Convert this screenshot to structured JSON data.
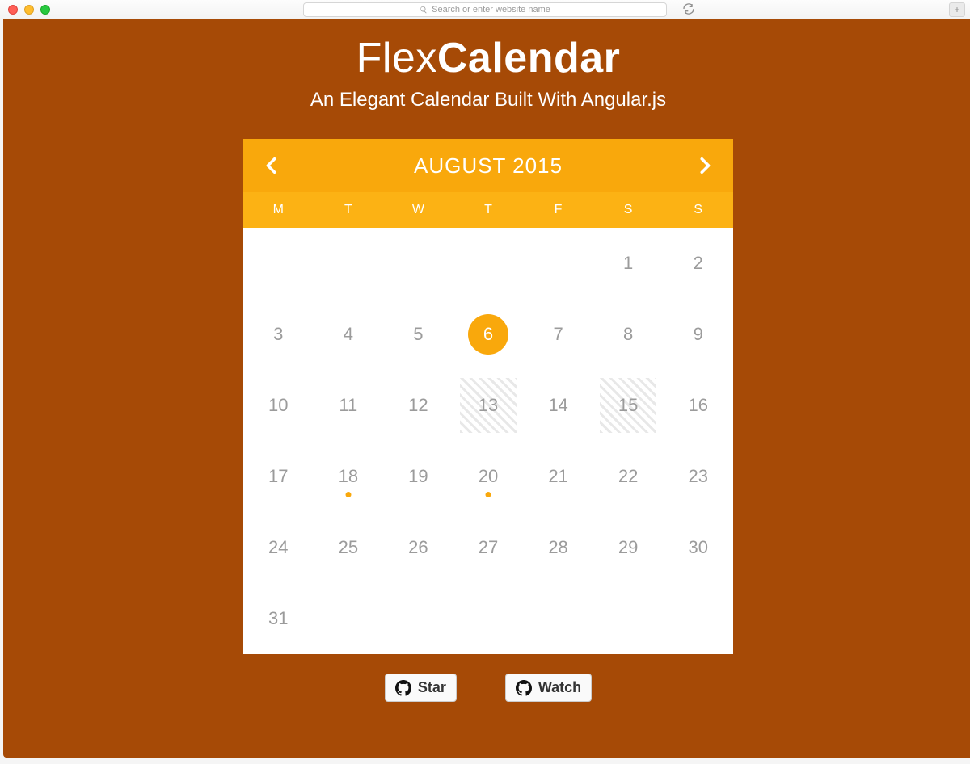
{
  "browser": {
    "placeholder": "Search or enter website name"
  },
  "header": {
    "title_light": "Flex",
    "title_bold": "Calendar",
    "subtitle": "An Elegant Calendar Built With Angular.js"
  },
  "calendar": {
    "month_label": "AUGUST 2015",
    "weekdays": [
      "M",
      "T",
      "W",
      "T",
      "F",
      "S",
      "S"
    ],
    "leading_blanks": 5,
    "days": [
      {
        "n": 1
      },
      {
        "n": 2
      },
      {
        "n": 3
      },
      {
        "n": 4
      },
      {
        "n": 5
      },
      {
        "n": 6,
        "selected": true
      },
      {
        "n": 7
      },
      {
        "n": 8
      },
      {
        "n": 9
      },
      {
        "n": 10
      },
      {
        "n": 11
      },
      {
        "n": 12
      },
      {
        "n": 13,
        "hatched": true
      },
      {
        "n": 14
      },
      {
        "n": 15,
        "hatched": true
      },
      {
        "n": 16
      },
      {
        "n": 17
      },
      {
        "n": 18,
        "dot": true
      },
      {
        "n": 19
      },
      {
        "n": 20,
        "dot": true
      },
      {
        "n": 21
      },
      {
        "n": 22
      },
      {
        "n": 23
      },
      {
        "n": 24
      },
      {
        "n": 25
      },
      {
        "n": 26
      },
      {
        "n": 27
      },
      {
        "n": 28
      },
      {
        "n": 29
      },
      {
        "n": 30
      },
      {
        "n": 31
      }
    ]
  },
  "buttons": {
    "star": "Star",
    "watch": "Watch"
  },
  "colors": {
    "page_bg": "#a64a06",
    "cal_header": "#f9a80c",
    "cal_weekday_bg": "#fcb214",
    "accent": "#f9a80c"
  }
}
